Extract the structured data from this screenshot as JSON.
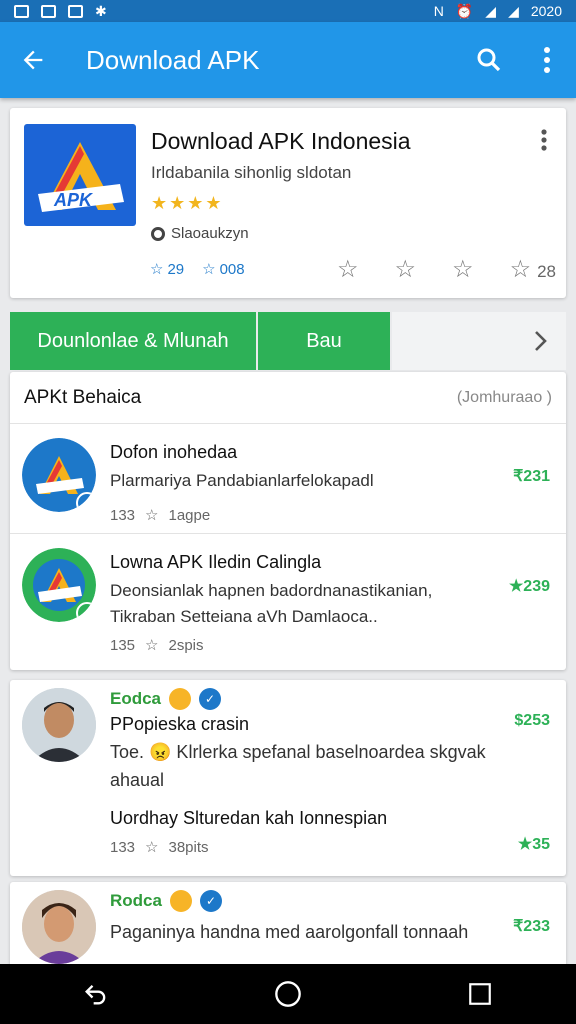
{
  "status_bar": {
    "time": "2020"
  },
  "app_bar": {
    "title": "Download APK"
  },
  "hero": {
    "logo_text": "APK",
    "title": "Download APK Indonesia",
    "subtitle": "Irldabanila sihonlig sldotan",
    "stars": "★★★★",
    "size": "Slaoaukzyn",
    "rating_a": "29",
    "rating_b": "008",
    "rating_count": "28"
  },
  "actions": {
    "primary": "Dounlonlae & Mlunah",
    "secondary": "Bau"
  },
  "list": {
    "title": "APKt Behaica",
    "pill": "(Jomhuraao )",
    "items": [
      {
        "title": "Dofon inohedaa",
        "desc": "Plarmariya Pandabianlarfelokapadl",
        "meta_count": "133",
        "meta_label": "1agpe",
        "price": "₹231",
        "color": "#1d78c9"
      },
      {
        "title": "Lowna APK Iledin Calingla",
        "desc": "Deonsianlak hapnen badordnanastikanian, Tikraban Setteiana aVh Damlaoca..",
        "meta_count": "135",
        "meta_label": "2spis",
        "price": "★239",
        "color": "#2db157"
      }
    ]
  },
  "review1": {
    "name": "Eodca",
    "subtitle": "PPopieska crasin",
    "text": "Toe. 😠 Klrlerka spefanal baselnoardea skgvak ahaual",
    "link": "Uordhay Slturedan kah Ionnespian",
    "meta_count": "133",
    "meta_label": "38pits",
    "price": "$253",
    "score": "★35"
  },
  "review2": {
    "name": "Rodca",
    "text": "Paganinya handna med aarolgonfall tonnaah",
    "price": "₹233"
  }
}
